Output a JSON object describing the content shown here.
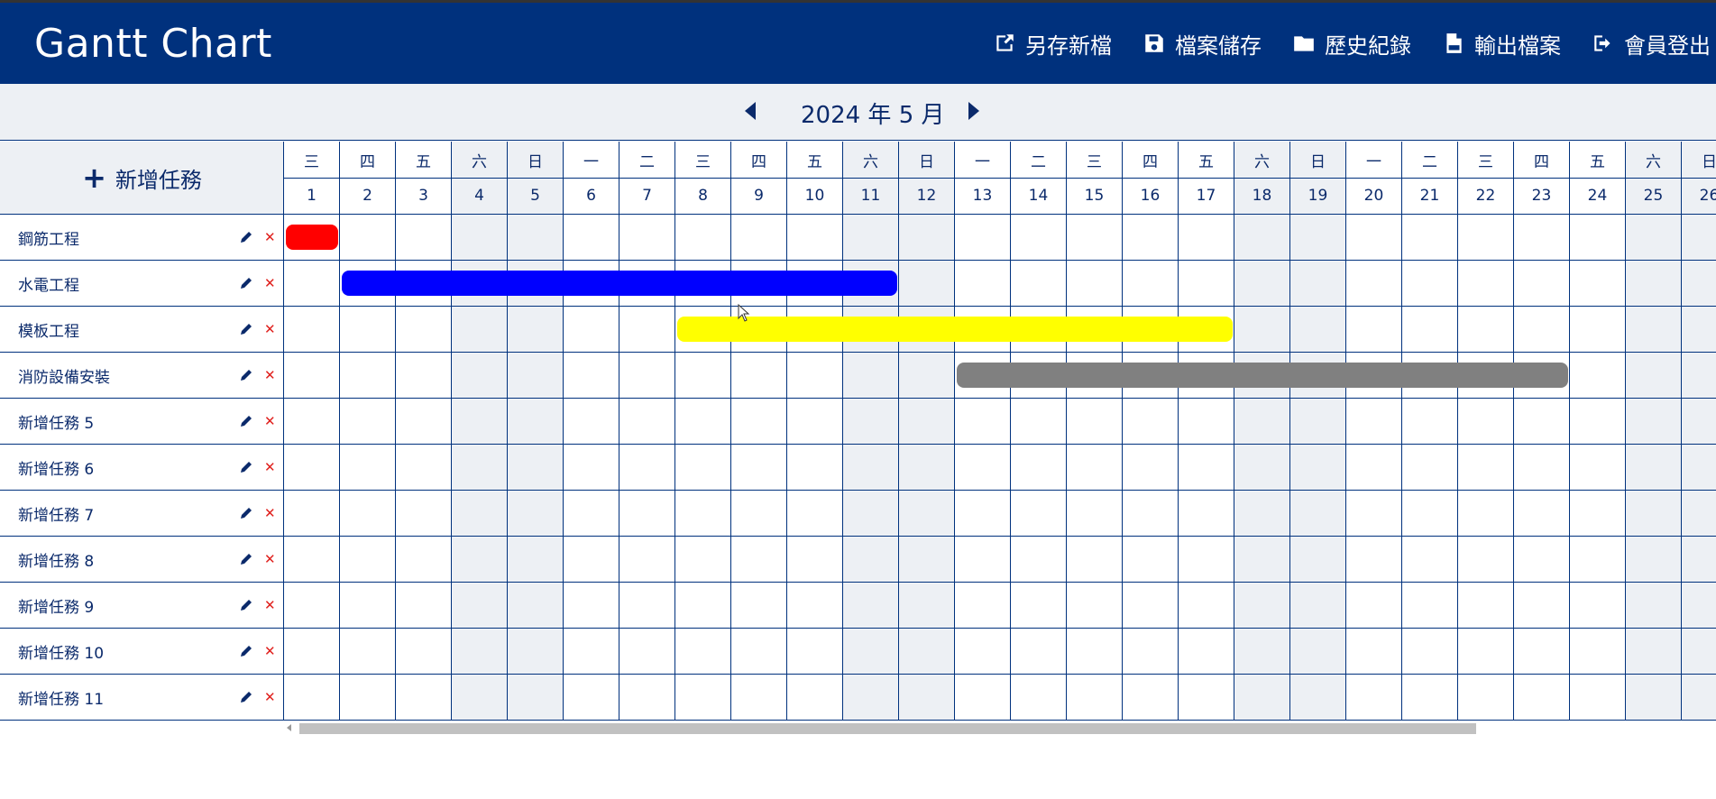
{
  "app": {
    "title": "Gantt Chart"
  },
  "nav": [
    {
      "label": "另存新檔",
      "icon": "share-export-icon"
    },
    {
      "label": "檔案儲存",
      "icon": "save-disk-icon"
    },
    {
      "label": "歷史紀錄",
      "icon": "folder-icon"
    },
    {
      "label": "輸出檔案",
      "icon": "pdf-file-icon"
    },
    {
      "label": "會員登出",
      "icon": "sign-out-icon"
    }
  ],
  "calendar": {
    "month_label": "2024 年 5 月",
    "days": [
      {
        "dow": "三",
        "date": "1",
        "weekend": false
      },
      {
        "dow": "四",
        "date": "2",
        "weekend": false
      },
      {
        "dow": "五",
        "date": "3",
        "weekend": false
      },
      {
        "dow": "六",
        "date": "4",
        "weekend": true
      },
      {
        "dow": "日",
        "date": "5",
        "weekend": true
      },
      {
        "dow": "一",
        "date": "6",
        "weekend": false
      },
      {
        "dow": "二",
        "date": "7",
        "weekend": false
      },
      {
        "dow": "三",
        "date": "8",
        "weekend": false
      },
      {
        "dow": "四",
        "date": "9",
        "weekend": false
      },
      {
        "dow": "五",
        "date": "10",
        "weekend": false
      },
      {
        "dow": "六",
        "date": "11",
        "weekend": true
      },
      {
        "dow": "日",
        "date": "12",
        "weekend": true
      },
      {
        "dow": "一",
        "date": "13",
        "weekend": false
      },
      {
        "dow": "二",
        "date": "14",
        "weekend": false
      },
      {
        "dow": "三",
        "date": "15",
        "weekend": false
      },
      {
        "dow": "四",
        "date": "16",
        "weekend": false
      },
      {
        "dow": "五",
        "date": "17",
        "weekend": false
      },
      {
        "dow": "六",
        "date": "18",
        "weekend": true
      },
      {
        "dow": "日",
        "date": "19",
        "weekend": true
      },
      {
        "dow": "一",
        "date": "20",
        "weekend": false
      },
      {
        "dow": "二",
        "date": "21",
        "weekend": false
      },
      {
        "dow": "三",
        "date": "22",
        "weekend": false
      },
      {
        "dow": "四",
        "date": "23",
        "weekend": false
      },
      {
        "dow": "五",
        "date": "24",
        "weekend": false
      },
      {
        "dow": "六",
        "date": "25",
        "weekend": true
      },
      {
        "dow": "日",
        "date": "26",
        "weekend": true
      }
    ]
  },
  "add_task_label": "新增任務",
  "tasks": [
    {
      "name": "鋼筋工程",
      "start": 1,
      "end": 1,
      "color": "#ff0000"
    },
    {
      "name": "水電工程",
      "start": 2,
      "end": 11,
      "color": "#0000ff"
    },
    {
      "name": "模板工程",
      "start": 8,
      "end": 17,
      "color": "#ffff00"
    },
    {
      "name": "消防設備安裝",
      "start": 13,
      "end": 23,
      "color": "#808080"
    },
    {
      "name": "新增任務 5"
    },
    {
      "name": "新增任務 6"
    },
    {
      "name": "新增任務 7"
    },
    {
      "name": "新增任務 8"
    },
    {
      "name": "新增任務 9"
    },
    {
      "name": "新增任務 10"
    },
    {
      "name": "新增任務 11"
    }
  ],
  "delete_glyph": "✕",
  "colors": {
    "header": "#00317d",
    "weekend": "#edf0f4",
    "delete": "#e0201d"
  }
}
